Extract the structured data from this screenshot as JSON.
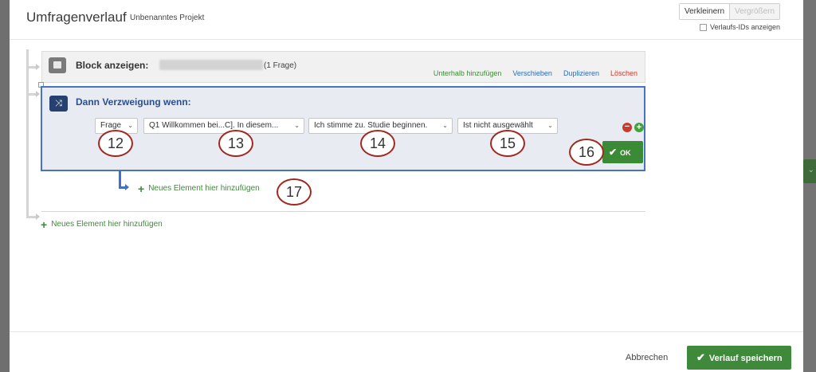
{
  "header": {
    "title": "Umfragenverlauf",
    "project": "Unbenanntes Projekt",
    "zoom_out": "Verkleinern",
    "zoom_in": "Vergrößern",
    "show_ids": "Verlaufs-IDs anzeigen"
  },
  "block": {
    "label": "Block anzeigen:",
    "count": "(1 Frage)",
    "actions": {
      "add_below": "Unterhalb hinzufügen",
      "move": "Verschieben",
      "duplicate": "Duplizieren",
      "delete": "Löschen"
    }
  },
  "branch": {
    "title": "Dann Verzweigung wenn:",
    "conditions": {
      "type": "Frage",
      "question": "Q1 Willkommen bei...C]. In diesem...",
      "choice": "Ich stimme zu. Studie beginnen.",
      "operator": "Ist nicht ausgewählt"
    },
    "ok": "OK"
  },
  "callouts": [
    "12",
    "13",
    "14",
    "15",
    "16",
    "17"
  ],
  "add_element_label": "Neues Element hier hinzufügen",
  "footer": {
    "cancel": "Abbrechen",
    "save": "Verlauf speichern"
  },
  "colors": {
    "accent_green": "#3f8a3a",
    "branch_blue": "#4a72c4",
    "callout_red": "#a2281f"
  }
}
